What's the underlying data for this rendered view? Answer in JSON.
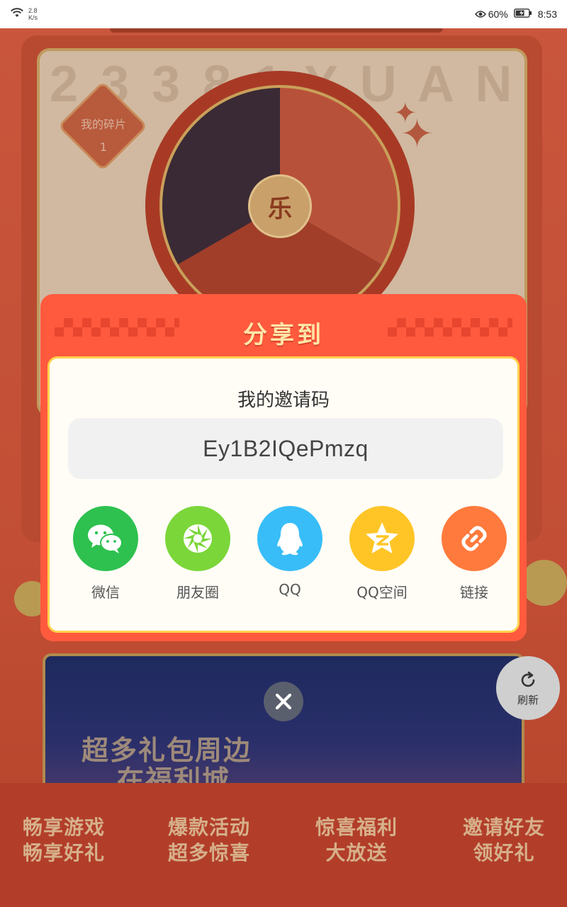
{
  "status_bar": {
    "net_speed_value": "2.8",
    "net_speed_unit": "K/s",
    "battery": "60%",
    "time": "8:53"
  },
  "background": {
    "banner_text": "2 3 3 8 1   Y U A N",
    "shard_label": "我的碎片",
    "shard_count": "1",
    "wheel_center": "乐",
    "promo_line1": "超多礼包周边",
    "promo_line2": "在福利城",
    "refresh_label": "刷新",
    "features": [
      {
        "line1": "畅享游戏",
        "line2": "畅享好礼"
      },
      {
        "line1": "爆款活动",
        "line2": "超多惊喜"
      },
      {
        "line1": "惊喜福利",
        "line2": "大放送"
      },
      {
        "line1": "邀请好友",
        "line2": "领好礼"
      }
    ]
  },
  "dialog": {
    "title": "分享到",
    "invite_label": "我的邀请码",
    "invite_code": "Ey1B2IQePmzq",
    "share_targets": [
      {
        "label": "微信",
        "icon": "wechat-icon",
        "color": "#2ec14f"
      },
      {
        "label": "朋友圈",
        "icon": "moments-icon",
        "color": "#7bd63a"
      },
      {
        "label": "QQ",
        "icon": "qq-icon",
        "color": "#38bdf8"
      },
      {
        "label": "QQ空间",
        "icon": "qzone-icon",
        "color": "#ffc527"
      },
      {
        "label": "链接",
        "icon": "link-icon",
        "color": "#ff7a3c"
      }
    ]
  },
  "colors": {
    "dialog_red": "#ff5a3e",
    "dialog_border_gold": "#ffd34d",
    "title_text": "#ffe6a8"
  }
}
